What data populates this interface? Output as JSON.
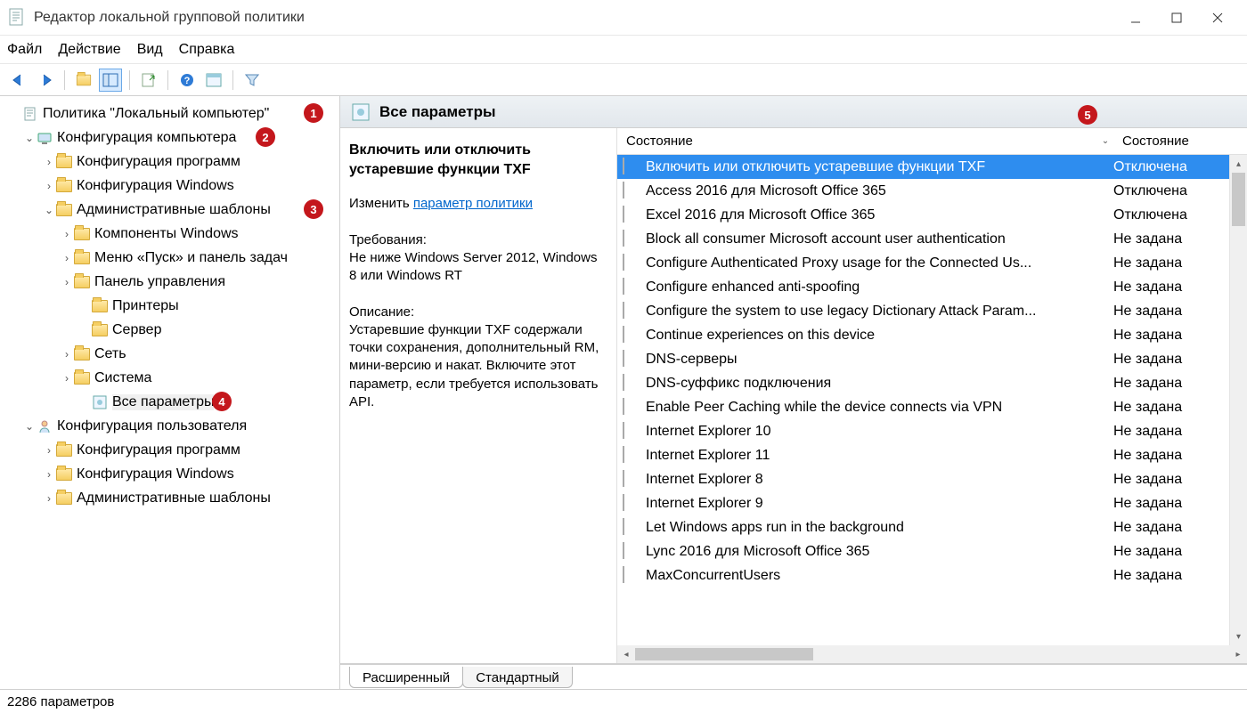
{
  "window": {
    "title": "Редактор локальной групповой политики"
  },
  "menu": {
    "file": "Файл",
    "action": "Действие",
    "view": "Вид",
    "help": "Справка"
  },
  "tree": {
    "root": "Политика \"Локальный компьютер\"",
    "comp_cfg": "Конфигурация компьютера",
    "cfg_prog": "Конфигурация программ",
    "cfg_win": "Конфигурация Windows",
    "adm_tpl": "Административные шаблоны",
    "comp_win": "Компоненты Windows",
    "start_menu": "Меню «Пуск» и панель задач",
    "ctrl_panel": "Панель управления",
    "printers": "Принтеры",
    "server": "Сервер",
    "network": "Сеть",
    "system": "Система",
    "all_settings": "Все параметры",
    "user_cfg": "Конфигурация пользователя",
    "u_cfg_prog": "Конфигурация программ",
    "u_cfg_win": "Конфигурация Windows",
    "u_adm_tpl": "Административные шаблоны"
  },
  "section": {
    "title": "Все параметры"
  },
  "desc": {
    "heading": "Включить или отключить устаревшие функции TXF",
    "edit_label": "Изменить",
    "edit_link": "параметр политики",
    "req_label": "Требования:",
    "req_text": "Не ниже Windows Server 2012, Windows 8 или Windows RT",
    "desc_label": "Описание:",
    "desc_text": "Устаревшие функции TXF содержали точки сохранения, дополнительный RM, мини-версию и накат. Включите этот параметр, если требуется использовать API."
  },
  "columns": {
    "name": "Состояние",
    "state": "Состояние"
  },
  "rows": [
    {
      "name": "Включить или отключить устаревшие функции TXF",
      "state": "Отключена",
      "selected": true
    },
    {
      "name": "Access 2016 для Microsoft Office 365",
      "state": "Отключена"
    },
    {
      "name": "Excel 2016 для Microsoft Office 365",
      "state": "Отключена"
    },
    {
      "name": "Block all consumer Microsoft account user authentication",
      "state": "Не задана"
    },
    {
      "name": "Configure Authenticated Proxy usage for the Connected Us...",
      "state": "Не задана"
    },
    {
      "name": "Configure enhanced anti-spoofing",
      "state": "Не задана"
    },
    {
      "name": "Configure the system to use legacy Dictionary Attack Param...",
      "state": "Не задана"
    },
    {
      "name": "Continue experiences on this device",
      "state": "Не задана"
    },
    {
      "name": "DNS-серверы",
      "state": "Не задана"
    },
    {
      "name": "DNS-суффикс подключения",
      "state": "Не задана"
    },
    {
      "name": "Enable Peer Caching while the device connects via VPN",
      "state": "Не задана"
    },
    {
      "name": "Internet Explorer 10",
      "state": "Не задана"
    },
    {
      "name": "Internet Explorer 11",
      "state": "Не задана"
    },
    {
      "name": "Internet Explorer 8",
      "state": "Не задана"
    },
    {
      "name": "Internet Explorer 9",
      "state": "Не задана"
    },
    {
      "name": "Let Windows apps run in the background",
      "state": "Не задана"
    },
    {
      "name": "Lync 2016 для Microsoft Office 365",
      "state": "Не задана"
    },
    {
      "name": "MaxConcurrentUsers",
      "state": "Не задана"
    }
  ],
  "tabs": {
    "extended": "Расширенный",
    "standard": "Стандартный"
  },
  "status": "2286 параметров",
  "badges": {
    "b1": "1",
    "b2": "2",
    "b3": "3",
    "b4": "4",
    "b5": "5"
  }
}
